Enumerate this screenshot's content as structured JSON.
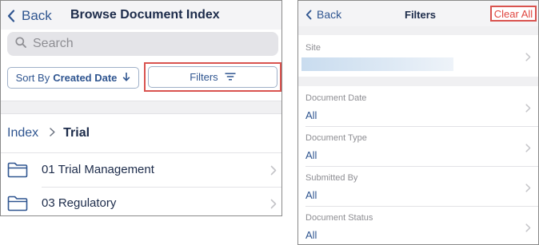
{
  "left": {
    "header": {
      "back_label": "Back",
      "title": "Browse Document Index"
    },
    "search": {
      "placeholder": "Search",
      "icon": "search-icon"
    },
    "sort": {
      "prefix": "Sort By",
      "field": "Created Date",
      "icon": "arrow-down-icon"
    },
    "filters_button": {
      "label": "Filters",
      "icon": "filter-lines-icon"
    },
    "breadcrumb": {
      "root": "Index",
      "current": "Trial"
    },
    "folders": [
      {
        "label": "01 Trial Management",
        "icon": "folder-icon"
      },
      {
        "label": "03 Regulatory",
        "icon": "folder-icon"
      }
    ]
  },
  "right": {
    "header": {
      "back_label": "Back",
      "title": "Filters",
      "clear_all": "Clear All"
    },
    "filters": [
      {
        "label": "Site",
        "value": ""
      },
      {
        "label": "Document Date",
        "value": "All"
      },
      {
        "label": "Document Type",
        "value": "All"
      },
      {
        "label": "Submitted By",
        "value": "All"
      },
      {
        "label": "Document Status",
        "value": "All"
      }
    ]
  },
  "colors": {
    "accent": "#2f5590",
    "highlight": "#d9534f",
    "text": "#1c2b4a",
    "muted": "#8e8e93"
  }
}
